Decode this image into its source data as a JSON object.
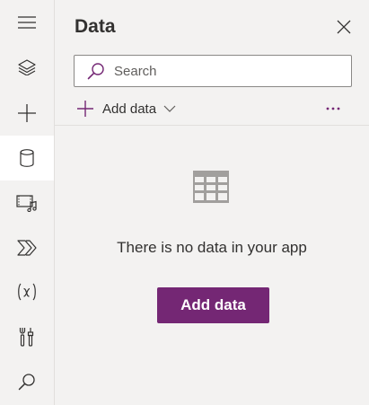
{
  "rail": {
    "items": [
      {
        "icon": "hamburger-icon"
      },
      {
        "icon": "layers-icon"
      },
      {
        "icon": "plus-icon"
      },
      {
        "icon": "database-icon",
        "active": true
      },
      {
        "icon": "media-icon"
      },
      {
        "icon": "power-automate-icon"
      },
      {
        "icon": "variables-icon"
      },
      {
        "icon": "tools-icon"
      },
      {
        "icon": "search-icon"
      }
    ]
  },
  "panel": {
    "title": "Data",
    "search": {
      "placeholder": "Search",
      "value": ""
    },
    "toolbar": {
      "add_data_label": "Add data"
    },
    "empty_message": "There is no data in your app",
    "primary_button_label": "Add data"
  },
  "colors": {
    "accent": "#742774",
    "active_rail_bg": "#ffffff",
    "panel_bg": "#f3f2f1"
  }
}
